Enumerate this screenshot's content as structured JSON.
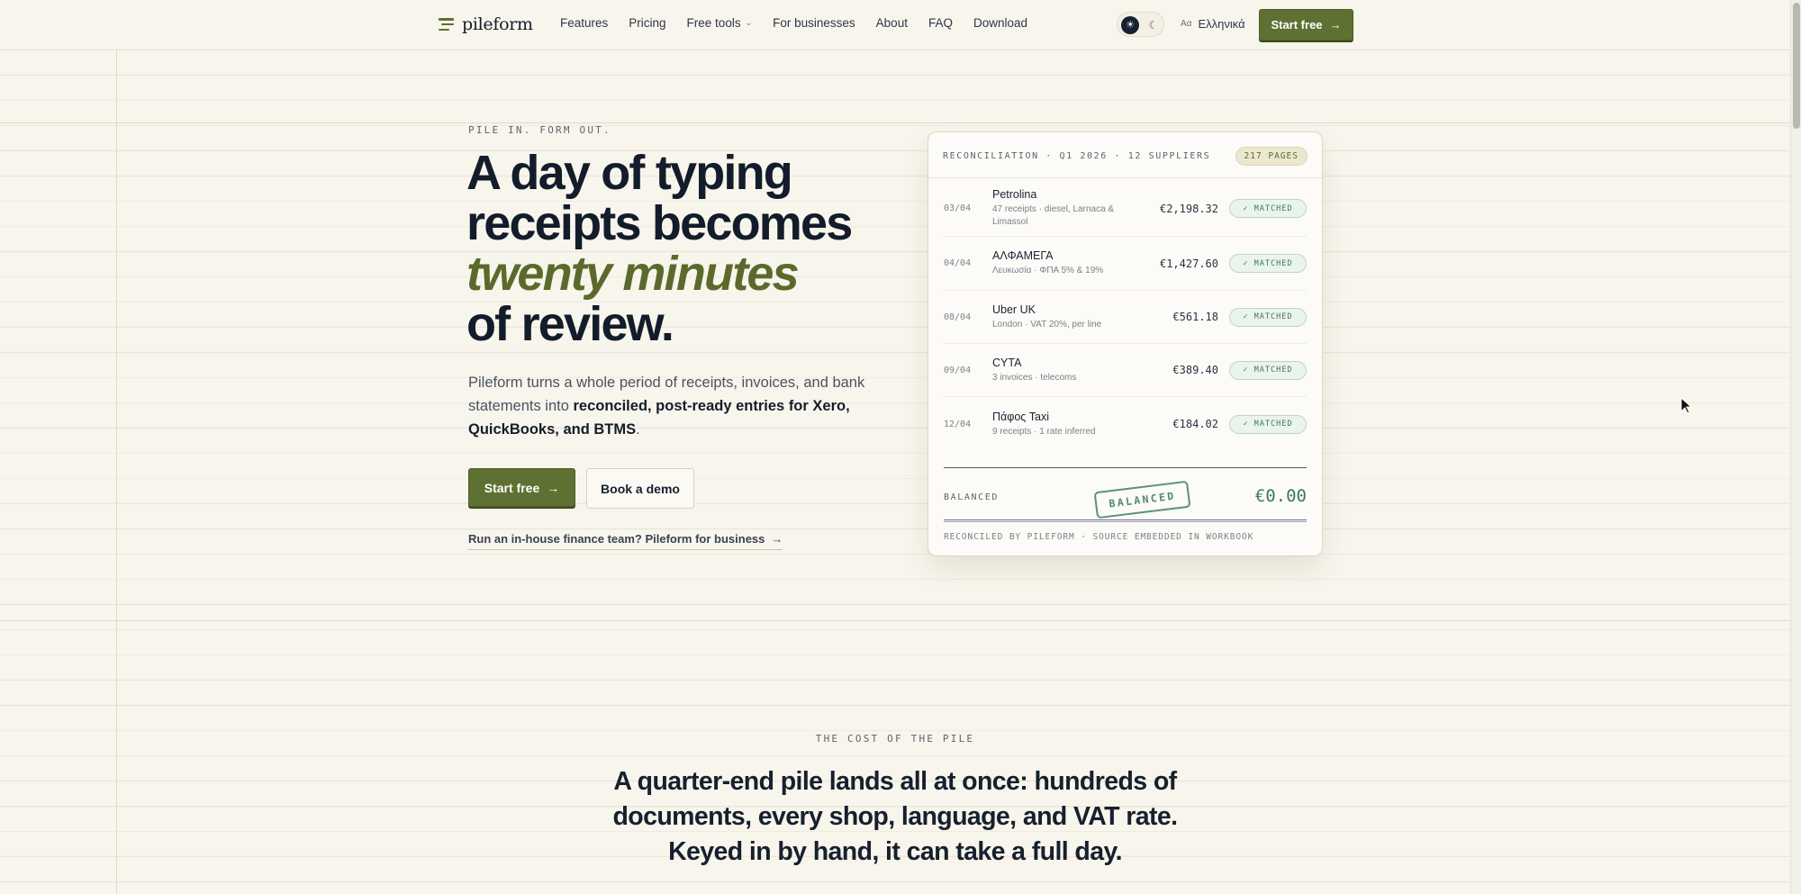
{
  "brand": {
    "name": "pileform"
  },
  "nav": {
    "items": [
      {
        "label": "Features"
      },
      {
        "label": "Pricing"
      },
      {
        "label": "Free tools"
      },
      {
        "label": "For businesses"
      },
      {
        "label": "About"
      },
      {
        "label": "FAQ"
      },
      {
        "label": "Download"
      }
    ]
  },
  "header": {
    "language": "Ελληνικά",
    "cta_label": "Start free"
  },
  "hero": {
    "eyebrow": "PILE IN. FORM OUT.",
    "title_line1": "A day of typing",
    "title_line2": "receipts becomes",
    "title_accent": "twenty minutes",
    "title_line4": "of review.",
    "sub_pre": "Pileform turns a whole period of receipts, invoices, and bank statements into ",
    "sub_bold": "reconciled, post-ready entries for Xero, QuickBooks, and BTMS",
    "sub_post": ".",
    "start_label": "Start free",
    "demo_label": "Book a demo",
    "business_link": "Run an in-house finance team? Pileform for business"
  },
  "card": {
    "meta": "RECONCILIATION · Q1 2026 · 12 SUPPLIERS",
    "pages": "217 PAGES",
    "rows": [
      {
        "date": "03/04",
        "name": "Petrolina",
        "detail": "47 receipts · diesel, Larnaca & Limassol",
        "amount": "€2,198.32",
        "status": "MATCHED"
      },
      {
        "date": "04/04",
        "name": "ΑΛΦΑΜΕΓΑ",
        "detail": "Λευκωσία · ΦΠΑ 5% & 19%",
        "amount": "€1,427.60",
        "status": "MATCHED"
      },
      {
        "date": "08/04",
        "name": "Uber UK",
        "detail": "London · VAT 20%, per line",
        "amount": "€561.18",
        "status": "MATCHED"
      },
      {
        "date": "09/04",
        "name": "CYTA",
        "detail": "3 invoices · telecoms",
        "amount": "€389.40",
        "status": "MATCHED"
      },
      {
        "date": "12/04",
        "name": "Πάφος Taxi",
        "detail": "9 receipts · 1 rate inferred",
        "amount": "€184.02",
        "status": "MATCHED"
      }
    ],
    "balanced_label": "BALANCED",
    "stamp": "BALANCED",
    "balance_amount": "€0.00",
    "footer": "RECONCILED BY PILEFORM · SOURCE EMBEDDED IN WORKBOOK"
  },
  "section2": {
    "eyebrow": "THE COST OF THE PILE",
    "title": "A quarter-end pile lands all at once: hundreds of documents, every shop, language, and VAT rate. Keyed in by hand, it can take a full day."
  },
  "icons": {
    "logo": "stacked-lines-icon",
    "chevron": "chevron-down-icon",
    "sun": "sun-icon",
    "moon": "moon-icon",
    "language": "translate-icon",
    "arrow": "arrow-right-icon",
    "check": "check-icon"
  },
  "colors": {
    "accent": "#5e7032",
    "background": "#f8f5ec",
    "text": "#16202e",
    "matched": "#3f7a5a"
  }
}
